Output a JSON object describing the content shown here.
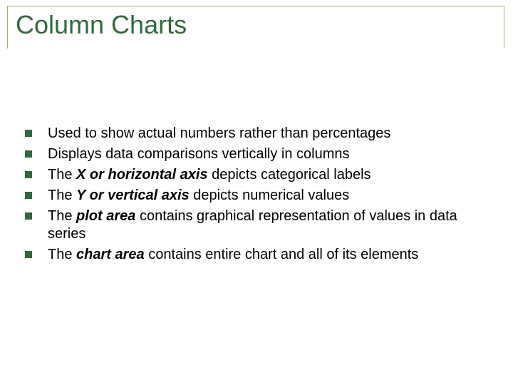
{
  "slide": {
    "title": "Column Charts",
    "bullets": [
      {
        "html": "Used to show actual numbers rather than percentages"
      },
      {
        "html": "Displays data comparisons vertically in columns"
      },
      {
        "html": "The <span class=\"bi\">X or horizontal axis</span> depicts categorical labels"
      },
      {
        "html": "The <span class=\"bi\">Y or vertical axis</span> depicts numerical values"
      },
      {
        "html": "The <span class=\"bi\">plot area</span> contains graphical representation of values in data series"
      },
      {
        "html": "The <span class=\"bi\">chart area</span> contains entire chart and all of its elements"
      }
    ]
  },
  "colors": {
    "accent": "#2e6b3a",
    "rule": "#b7a46f"
  }
}
